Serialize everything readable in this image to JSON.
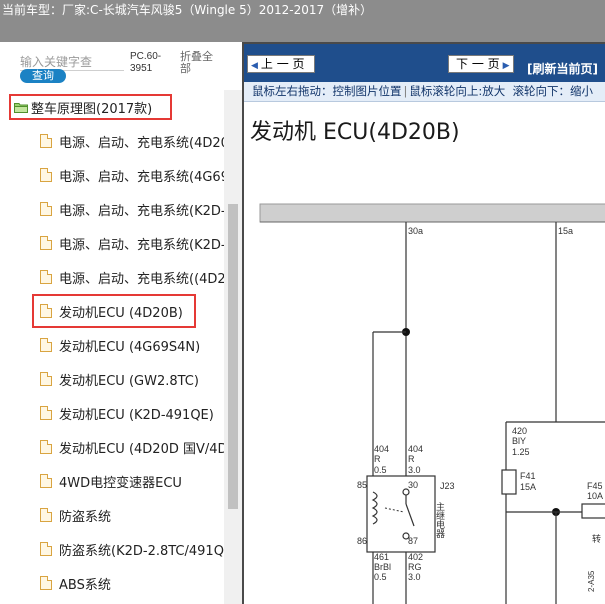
{
  "titlebar": {
    "label": "当前车型：",
    "text": "厂家:C-长城汽车风骏5（Wingle 5）2012-2017（增补）"
  },
  "search": {
    "placeholder": "输入关键字查",
    "query_label": "查询",
    "code": "PC.60-3951",
    "collapse_label": "折叠全部"
  },
  "tree": {
    "root": "整车原理图(2017款)",
    "items": [
      "电源、启动、充电系统(4D20",
      "电源、启动、充电系统(4G69",
      "电源、启动、充电系统(K2D-",
      "电源、启动、充电系统(K2D-",
      "电源、启动、充电系统((4D2",
      "发动机ECU (4D20B)",
      "发动机ECU (4G69S4N)",
      "发动机ECU (GW2.8TC)",
      "发动机ECU (K2D-491QE)",
      "发动机ECU (4D20D 国V/4D2",
      "4WD电控变速器ECU",
      "防盗系统",
      "防盗系统(K2D-2.8TC/491QE",
      "ABS系统"
    ]
  },
  "viewer": {
    "prev_label": "上 一 页",
    "next_label": "下 一 页",
    "refresh_label": "[刷新当前页]",
    "hint_drag": "鼠标左右拖动：控制图片位置",
    "hint_wheel_up": "鼠标滚轮向上:放大",
    "hint_wheel_down": "滚轮向下：缩小",
    "doc_title": "发动机 ECU(4D20B)"
  },
  "diagram": {
    "wire_30a": "30a",
    "wire_15a": "15a",
    "w404a_num": "404",
    "w404a_color": "R",
    "w404a_size": "0.5",
    "w404b_num": "404",
    "w404b_color": "R",
    "w404b_size": "3.0",
    "pin_85": "85",
    "pin_86": "86",
    "pin_30": "30",
    "pin_87": "87",
    "relay_id": "J23",
    "relay_desc": "主继电器",
    "w461_num": "461",
    "w461_color": "BrBl",
    "w461_size": "0.5",
    "w402_num": "402",
    "w402_color": "RG",
    "w402_size": "3.0",
    "w420_num": "420",
    "w420_color": "BlY",
    "w420_size": "1.25",
    "fuse_f41": "F41",
    "fuse_f41_rating": "15A",
    "fuse_f45": "F45",
    "fuse_f45_rating": "10A",
    "side_label": "转",
    "side_code": "2-A35"
  },
  "colors": {
    "titlebar_bg": "#8c8c8c",
    "toolbar_bg": "#1f4e8c",
    "query_button": "#1b82c4",
    "highlight_box": "#e53935"
  }
}
